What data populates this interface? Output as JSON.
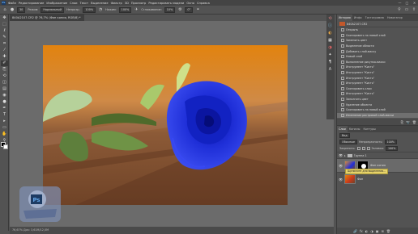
{
  "colors": {
    "ui_bg": "#535353",
    "panel_dark": "#444444",
    "canvas_bg": "#6b6b6b",
    "selected_history": "#707070",
    "tooltip_bg": "#e7d36a",
    "rose_blue": "#1f2fd8",
    "wood": "#7a4b2c"
  },
  "menu": {
    "app_icon": "Ps",
    "items": [
      "Файл",
      "Редактирование",
      "Изображение",
      "Слои",
      "Текст",
      "Выделение",
      "Фильтр",
      "3D",
      "Просмотр",
      "Редактировать модели",
      "Окно",
      "Справка"
    ],
    "window_controls": [
      "—",
      "□",
      "✕"
    ]
  },
  "options": {
    "brush_size": "30",
    "mode_label": "Режим:",
    "mode_value": "Нормальный",
    "opacity_label": "Непрозр.:",
    "opacity_value": "100%",
    "flow_label": "Нажим:",
    "flow_value": "100%",
    "smoothing_label": "Сглаживание:",
    "smoothing_value": "10%",
    "angle_value": "0°"
  },
  "tools": {
    "icons": [
      "move-icon",
      "marquee-icon",
      "lasso-icon",
      "quick-select-icon",
      "crop-icon",
      "eyedropper-icon",
      "healing-icon",
      "brush-icon",
      "stamp-icon",
      "history-brush-icon",
      "eraser-icon",
      "gradient-icon",
      "blur-icon",
      "dodge-icon",
      "pen-icon",
      "type-icon",
      "path-select-icon",
      "shape-icon",
      "hand-icon",
      "zoom-icon",
      "more-icon"
    ],
    "glyphs": [
      "✥",
      "⬚",
      "ℓ",
      "✎",
      "⌗",
      "⁄",
      "✚",
      "✐",
      "⎘",
      "⟲",
      "◫",
      "▤",
      "◉",
      "●",
      "✒",
      "T",
      "▸",
      "▭",
      "✋",
      "⚲",
      "…"
    ]
  },
  "document": {
    "tab_title": "840A2107.CR2 @ 76,7% (Фон копия, RGB/8) *",
    "status_text": "76,67%    Док: 3,61M/12,0M"
  },
  "history": {
    "tabs": [
      "История",
      "Инфо",
      "Гистограмма",
      "Навигатор"
    ],
    "snapshot_label": "840A2107.CR2",
    "items": [
      "Открыть",
      "Скопировать на новый слой",
      "Заменить цвет",
      "Выделение области",
      "Добавить слой-маску",
      "Новый слой",
      "Выполнение рисунка-маски",
      "Инструмент \"Кисть\"",
      "Инструмент \"Кисть\"",
      "Инструмент \"Кисть\"",
      "Инструмент \"Кисть\"",
      "Скопировать слои",
      "Инструмент \"Кисть\"",
      "Заполнить цвет",
      "Удаление объекта",
      "Скопировать на новый слой",
      "Изменение растровой слой-маски"
    ],
    "selected_index": 16,
    "bottom_icons": [
      "⎘",
      "📷",
      "🗑"
    ]
  },
  "layers": {
    "tabs": [
      "Слои",
      "Каналы",
      "Контуры"
    ],
    "filter_label": "Вид",
    "blend_value": "Обычные",
    "opacity_label": "Непрозрачность:",
    "opacity_value": "100%",
    "lock_label": "Закрепить:",
    "fill_label": "Заливка:",
    "fill_value": "100%",
    "group_name": "Группа 1",
    "layer_rows": [
      {
        "name": "Фон копия",
        "selected": true
      },
      {
        "name": "Фон",
        "selected": false
      }
    ],
    "tooltip": "Щелкните для выделения...",
    "bottom_icons": [
      "🔗",
      "fx",
      "◐",
      "◑",
      "▣",
      "⊞",
      "🗑"
    ]
  },
  "watermark": {
    "logo_text": "Ps"
  }
}
